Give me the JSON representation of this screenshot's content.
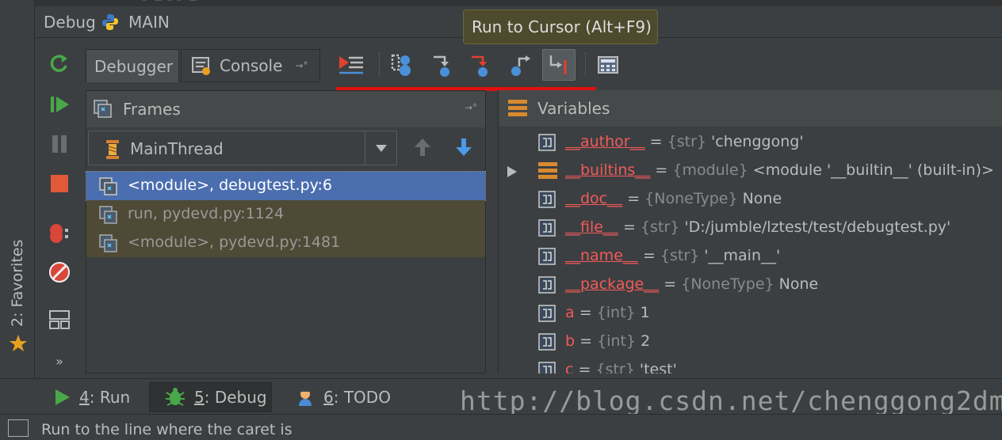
{
  "window": {
    "title": "Debug",
    "config_name": "MAIN"
  },
  "favorites": {
    "label": "2: Favorites"
  },
  "tabs": {
    "debugger": "Debugger",
    "console": "Console"
  },
  "tooltip": "Run to Cursor (Alt+F9)",
  "frames": {
    "title": "Frames",
    "thread": "MainThread",
    "items": [
      {
        "label": "<module>, debugtest.py:6",
        "selected": true
      },
      {
        "label": "run, pydevd.py:1124",
        "selected": false
      },
      {
        "label": "<module>, pydevd.py:1481",
        "selected": false
      }
    ]
  },
  "variables": {
    "title": "Variables",
    "items": [
      {
        "name": "__author__",
        "eq": "=",
        "type": "{str}",
        "value": "'chenggong'",
        "icon": "field"
      },
      {
        "name": "__builtins__",
        "eq": "=",
        "type": "{module}",
        "value": "<module '__builtin__' (built-in)>",
        "icon": "module"
      },
      {
        "name": "__doc__",
        "eq": "=",
        "type": "{NoneType}",
        "value": "None",
        "icon": "field"
      },
      {
        "name": "__file__",
        "eq": "=",
        "type": "{str}",
        "value": "'D:/jumble/lztest/test/debugtest.py'",
        "icon": "field"
      },
      {
        "name": "__name__",
        "eq": "=",
        "type": "{str}",
        "value": "'__main__'",
        "icon": "field"
      },
      {
        "name": "__package__",
        "eq": "=",
        "type": "{NoneType}",
        "value": "None",
        "icon": "field"
      },
      {
        "name": "a",
        "eq": "=",
        "type": "{int}",
        "value": "1",
        "icon": "field"
      },
      {
        "name": "b",
        "eq": "=",
        "type": "{int}",
        "value": "2",
        "icon": "field"
      },
      {
        "name": "c",
        "eq": "=",
        "type": "{str}",
        "value": "'test'",
        "icon": "field"
      }
    ]
  },
  "bottom_tabs": {
    "run_num": "4",
    "run_label": ": Run",
    "debug_num": "5",
    "debug_label": ": Debug",
    "todo_num": "6",
    "todo_label": ": TODO"
  },
  "watermark": "http://blog.csdn.net/chenggong2dm",
  "status": "Run to the line where the caret is",
  "colors": {
    "accent_red": "#e01010",
    "selection": "#4b6eaf",
    "var_name": "#f05a5a"
  }
}
